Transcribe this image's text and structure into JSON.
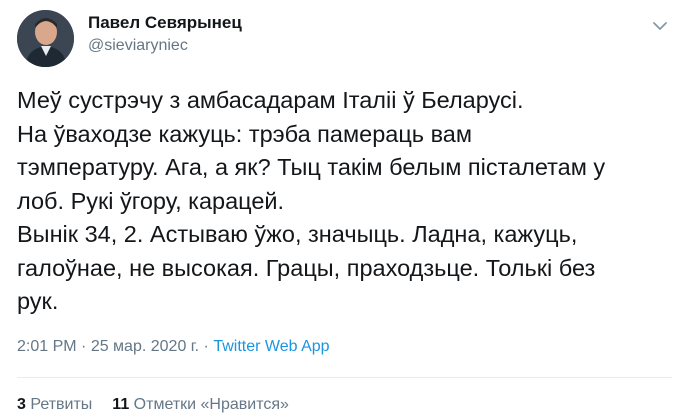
{
  "tweet": {
    "author_name": "Павел Севярынец",
    "author_handle": "@sieviaryniec",
    "menu_icon": "chevron-down-icon",
    "lines": [
      "Меў сустрэчу з амбасадарам Італіі ў Беларусі.",
      "На ўваходзе кажуць: трэба памераць вам",
      "тэмпературу. Ага, а як? Тыц такім белым пісталетам у",
      "лоб. Рукі ўгору, карацей.",
      "Вынік 34, 2. Астываю ўжо, значыць. Ладна, кажуць,",
      "галоўнае, не высокая. Грацы, праходзьце. Толькі без",
      "рук."
    ],
    "time": "2:01 PM",
    "separator": " · ",
    "date": "25 мар. 2020 г.",
    "app": "Twitter Web App"
  },
  "stats": {
    "retweets_count": "3",
    "retweets_label": "Ретвиты",
    "likes_count": "11",
    "likes_label": "Отметки «Нравится»"
  }
}
